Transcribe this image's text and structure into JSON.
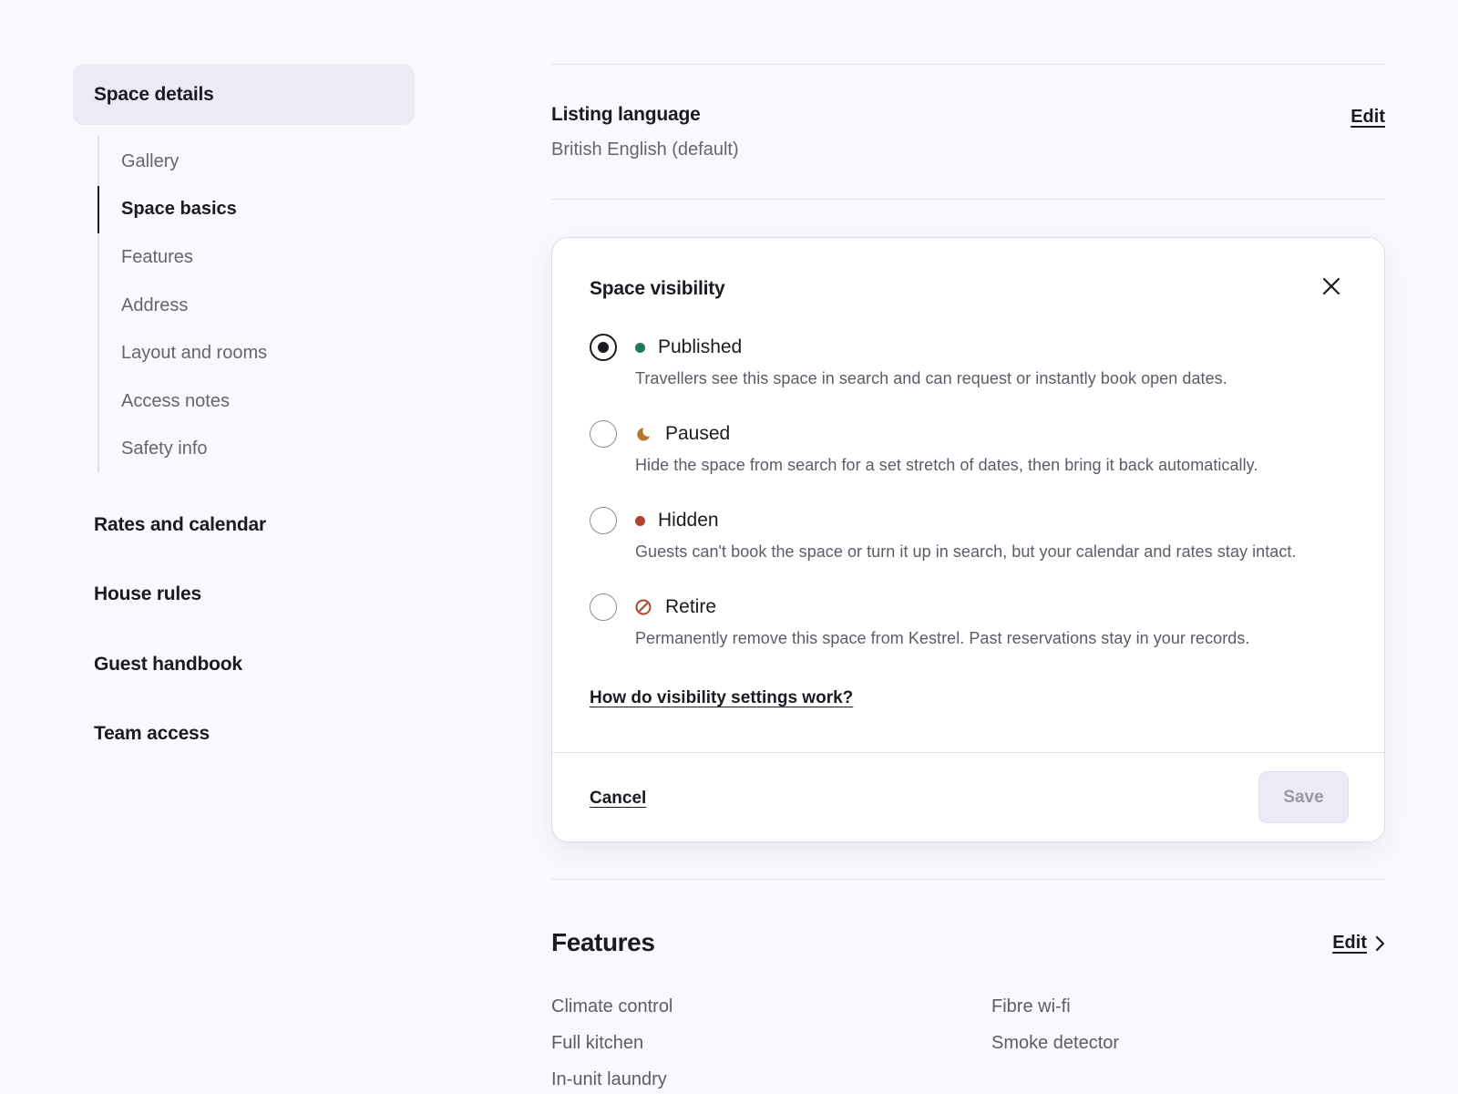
{
  "sidebar": {
    "active_section": "Space details",
    "subnav": [
      "Gallery",
      "Space basics",
      "Features",
      "Address",
      "Layout and rooms",
      "Access notes",
      "Safety info"
    ],
    "active_subnav": "Space basics",
    "sections": [
      "Rates and calendar",
      "House rules",
      "Guest handbook",
      "Team access"
    ]
  },
  "listing_language": {
    "title": "Listing language",
    "value": "British English (default)",
    "edit_label": "Edit"
  },
  "visibility": {
    "title": "Space visibility",
    "close_icon": "close-icon",
    "selected": "Published",
    "options": [
      {
        "label": "Published",
        "icon": "green-dot-icon",
        "color": "#1f7a5a",
        "description": "Travellers see this space in search and can request or instantly book open dates."
      },
      {
        "label": "Paused",
        "icon": "moon-icon",
        "color": "#b5772a",
        "description": "Hide the space from search for a set stretch of dates, then bring it back automatically."
      },
      {
        "label": "Hidden",
        "icon": "red-dot-icon",
        "color": "#b2432b",
        "description": "Guests can't book the space or turn it up in search, but your calendar and rates stay intact."
      },
      {
        "label": "Retire",
        "icon": "prohibited-icon",
        "color": "#b2432b",
        "description": "Permanently remove this space from Kestrel. Past reservations stay in your records."
      }
    ],
    "help_link": "How do visibility settings work?",
    "cancel_label": "Cancel",
    "save_label": "Save"
  },
  "features": {
    "title": "Features",
    "edit_label": "Edit",
    "items": [
      "Climate control",
      "Fibre wi-fi",
      "Full kitchen",
      "Smoke detector",
      "In-unit laundry"
    ]
  },
  "colors": {
    "page_background": "#f9f9fd",
    "active_nav_background": "#ecebf5",
    "text_primary": "#1b1a20",
    "text_secondary": "#66646f"
  }
}
